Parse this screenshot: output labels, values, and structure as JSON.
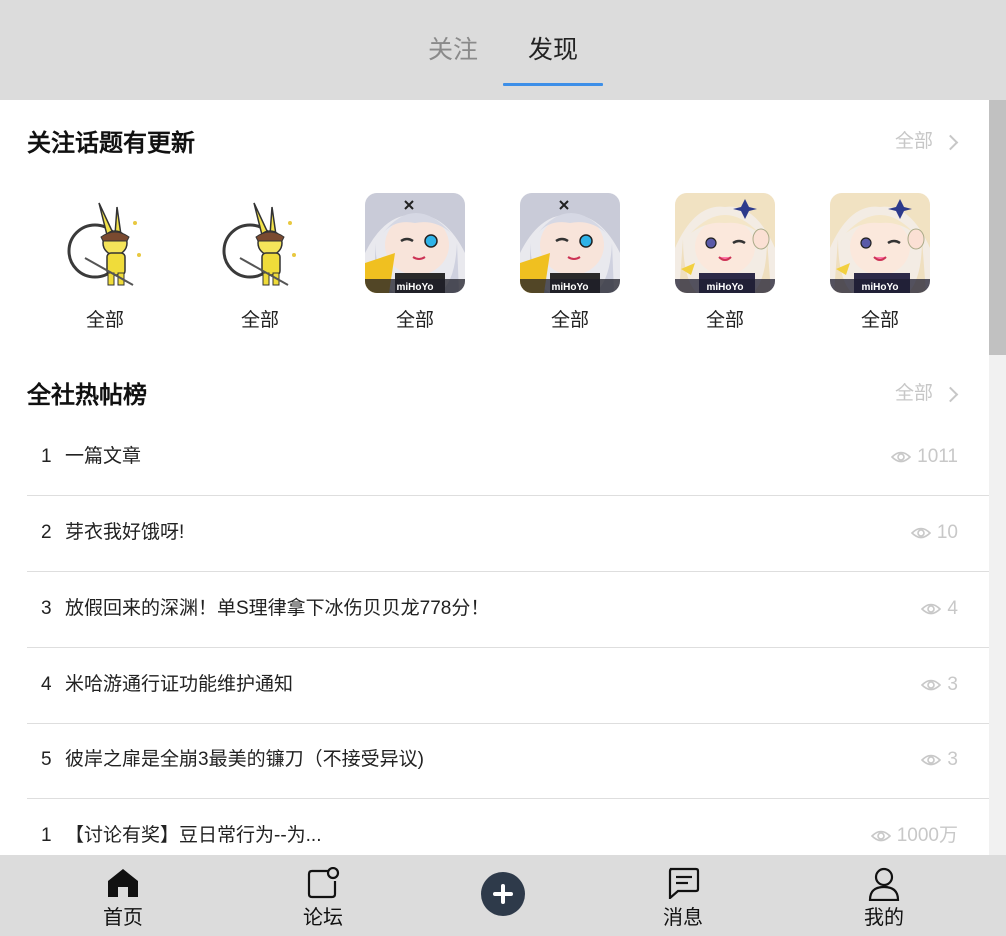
{
  "tabs": [
    {
      "label": "关注",
      "active": false
    },
    {
      "label": "发现",
      "active": true
    }
  ],
  "accent_color": "#3d8fe8",
  "followed_topics": {
    "title": "关注话题有更新",
    "see_all": "全部",
    "items": [
      {
        "label": "全部",
        "icon": "bunny-character-icon"
      },
      {
        "label": "全部",
        "icon": "bunny-character-icon"
      },
      {
        "label": "全部",
        "icon": "anime-girl-white-hair-icon",
        "watermark": "miHoYo"
      },
      {
        "label": "全部",
        "icon": "anime-girl-white-hair-icon",
        "watermark": "miHoYo"
      },
      {
        "label": "全部",
        "icon": "anime-girl-blonde-icon",
        "watermark": "miHoYo"
      },
      {
        "label": "全部",
        "icon": "anime-girl-blonde-icon",
        "watermark": "miHoYo"
      }
    ]
  },
  "hot_posts": {
    "title": "全社热帖榜",
    "see_all": "全部",
    "items": [
      {
        "rank": "1",
        "title": "一篇文章",
        "views": "1011"
      },
      {
        "rank": "2",
        "title": "芽衣我好饿呀!",
        "views": "10"
      },
      {
        "rank": "3",
        "title": "放假回来的深渊！单S理律拿下冰伤贝贝龙778分！",
        "views": "4"
      },
      {
        "rank": "4",
        "title": "米哈游通行证功能维护通知",
        "views": "3"
      },
      {
        "rank": "5",
        "title": "彼岸之扉是全崩3最美的镰刀（不接受异议)",
        "views": "3"
      },
      {
        "rank": "1",
        "title": "【讨论有奖】豆日常行为--为...",
        "views": "1000万"
      }
    ]
  },
  "bottom_nav": [
    {
      "label": "首页",
      "icon": "home-icon"
    },
    {
      "label": "论坛",
      "icon": "forum-icon"
    },
    {
      "label": "",
      "icon": "plus-icon"
    },
    {
      "label": "消息",
      "icon": "message-icon"
    },
    {
      "label": "我的",
      "icon": "user-icon"
    }
  ]
}
